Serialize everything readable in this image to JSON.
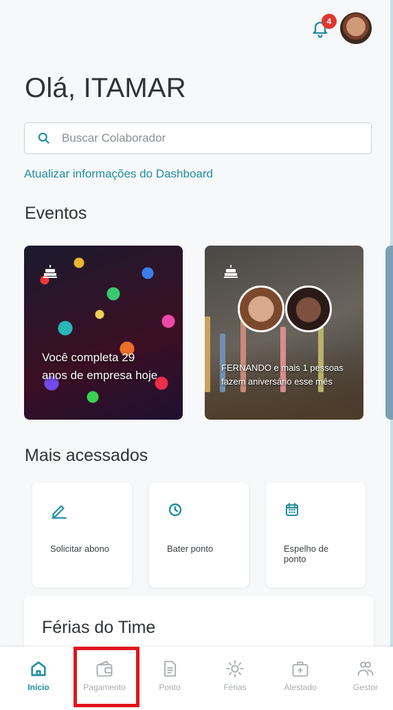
{
  "header": {
    "notification_count": "4",
    "greeting": "Olá, ITAMAR"
  },
  "search": {
    "placeholder": "Buscar Colaborador"
  },
  "update_link": "Atualizar informações do Dashboard",
  "events": {
    "title": "Eventos",
    "cards": [
      {
        "icon": "cake-icon",
        "text": "Você completa 29 anos de empresa hoje"
      },
      {
        "icon": "cake-icon",
        "text": "FERNANDO e mais 1 pessoas fazem aniversário esse mês"
      }
    ]
  },
  "most_accessed": {
    "title": "Mais acessados",
    "items": [
      {
        "icon": "pencil-icon",
        "label": "Solicitar abono"
      },
      {
        "icon": "clock-icon",
        "label": "Bater ponto"
      },
      {
        "icon": "calendar-icon",
        "label": "Espelho de ponto"
      }
    ]
  },
  "team_vacation": {
    "title": "Férias do Time"
  },
  "bottom_nav": {
    "items": [
      {
        "label": "Início",
        "icon": "home-icon",
        "active": true
      },
      {
        "label": "Pagamento",
        "icon": "wallet-icon",
        "active": false
      },
      {
        "label": "Ponto",
        "icon": "document-icon",
        "active": false
      },
      {
        "label": "Férias",
        "icon": "sun-icon",
        "active": false
      },
      {
        "label": "Atestado",
        "icon": "medical-bag-icon",
        "active": false
      },
      {
        "label": "Gestor",
        "icon": "team-icon",
        "active": false
      }
    ]
  },
  "colors": {
    "accent": "#1f8ea0",
    "badge": "#e1362f",
    "highlight": "#e0151b"
  }
}
